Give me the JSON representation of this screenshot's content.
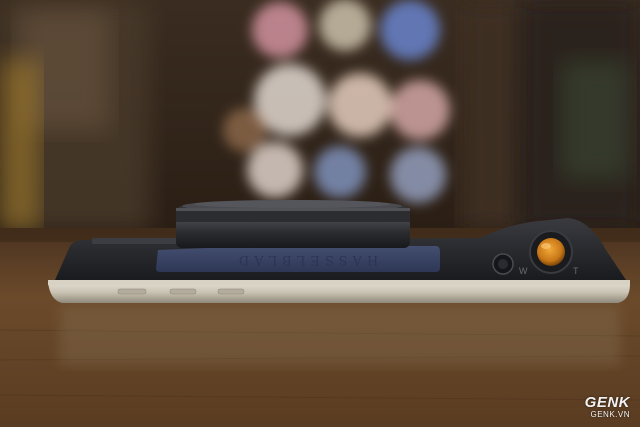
{
  "photo": {
    "subject": "Hasselblad camera mod attached to a smartphone, side view",
    "brand_label": "HASSELBLAD",
    "zoom_wide_label": "W",
    "zoom_tele_label": "T"
  },
  "watermark": {
    "logo": "GENK",
    "site": "GENK.VN"
  },
  "colors": {
    "table_wood": "#6b4a2a",
    "phone_frame": "#c9c2b2",
    "camera_body": "#232428",
    "grip_panel": "#3a4468",
    "shutter_accent": "#d98a1e"
  }
}
